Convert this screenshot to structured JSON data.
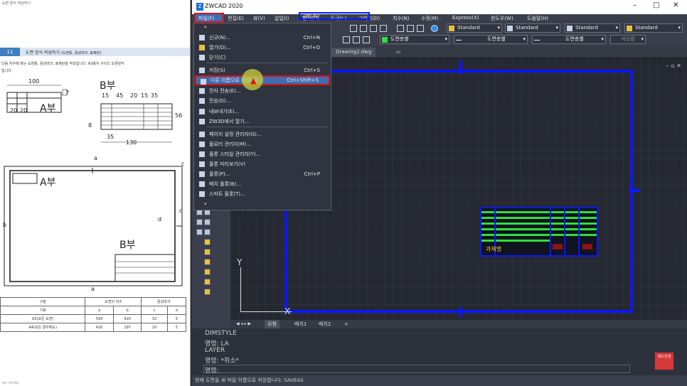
{
  "doc": {
    "toptxt": "도면 양식 작성하기",
    "sec_num": "11",
    "sec_title": "도면 양식 작성하기",
    "sec_title_small": "(도면틀, 중심마크, 표제란)",
    "body_line1": "다음 치수에 맞는 도면틀, 중심마크, 표제란을 작성합니다. A3용지 사이즈 도면양식",
    "body_line2": "입니다.",
    "label_A": "A부",
    "label_B": "B부",
    "dims": [
      "100",
      "15",
      "45",
      "20",
      "15",
      "35",
      "56",
      "35",
      "130",
      "20",
      "20",
      "7",
      "8",
      "a",
      "a",
      "b",
      "c",
      "d",
      "c"
    ],
    "table_headers": [
      "구분",
      "도면의 치수",
      "",
      "중심마크"
    ],
    "table_sub": [
      "기호",
      "a",
      "b",
      "c",
      "d"
    ],
    "table_row1": [
      "A3(모든 도면)",
      "594",
      "420",
      "10",
      "5"
    ],
    "table_row2": [
      "A4(모든 경우에도)",
      "420",
      "297",
      "10",
      "5"
    ],
    "footer": "캐드 아카데미"
  },
  "app": {
    "title": "ZWCAD 2020",
    "menus": [
      "파일(F)",
      "편집(E)",
      "뷰(V)",
      "삽입(I)",
      "형식(O)",
      "도구(L)",
      "그리기(D)",
      "치수(N)",
      "수정(M)",
      "Express(X)",
      "윈도우(W)",
      "도움말(H)"
    ],
    "style_dropdowns": [
      "Standard",
      "Standard",
      "Standard",
      "Standard"
    ],
    "layer_dropdown": "도면층별",
    "linetype_dropdown": "도면층별",
    "lineweight_dropdown": "도면층별",
    "color_dropdown": "색상별",
    "drawing_tab": "Drawing2.dwg",
    "drawing_label": "ZWCAD",
    "title_block_label": "과제명",
    "axis_x": "X",
    "axis_y": "Y",
    "layout_tabs": [
      "모형",
      "배치1",
      "배치2",
      "+"
    ],
    "cmd_lines": [
      "DIMSTYLE",
      "명령: LA",
      "LAYER",
      "명령: *취소*"
    ],
    "cmd_prompt": "명령:",
    "kr_badge": "캐드선생",
    "status": "현재 도면을 새 파일 이름으로 저장합니다:  SAVEAS"
  },
  "file_menu": {
    "items": [
      {
        "label": "신규(N)...",
        "shortcut": "Ctrl+N",
        "icon": "new-file-icon"
      },
      {
        "label": "열기(O)...",
        "shortcut": "Ctrl+O",
        "icon": "open-folder-icon"
      },
      {
        "label": "닫기(C)",
        "shortcut": "",
        "icon": "close-file-icon"
      },
      {
        "label": "저장(S)",
        "shortcut": "Ctrl+S",
        "icon": "save-icon"
      },
      {
        "label": "다른 이름으로 저장(A)...",
        "shortcut": "Ctrl+Shift+S",
        "icon": "save-as-icon"
      },
      {
        "label": "전자 전송(E)...",
        "shortcut": "",
        "icon": "etransmit-icon"
      },
      {
        "label": "전송(D)...",
        "shortcut": "",
        "icon": "send-icon"
      },
      {
        "label": "내보내기(E)...",
        "shortcut": "",
        "icon": "export-icon"
      },
      {
        "label": "ZW3D에서 열기...",
        "shortcut": "",
        "icon": "zw3d-icon"
      },
      {
        "label": "페이지 설정 관리자(G)...",
        "shortcut": "",
        "icon": "page-setup-icon"
      },
      {
        "label": "플로터 관리자(M)...",
        "shortcut": "",
        "icon": "plotter-icon"
      },
      {
        "label": "플롯 스타일 관리자(Y)...",
        "shortcut": "",
        "icon": "plot-style-icon"
      },
      {
        "label": "플롯 미리보기(V)",
        "shortcut": "",
        "icon": "plot-preview-icon"
      },
      {
        "label": "플롯(P)...",
        "shortcut": "Ctrl+P",
        "icon": "plot-icon"
      },
      {
        "label": "배치 플롯(B)...",
        "shortcut": "",
        "icon": "batch-plot-icon"
      },
      {
        "label": "스마트 플롯(T)...",
        "shortcut": "",
        "icon": "smart-plot-icon"
      }
    ]
  },
  "colors": {
    "accent": "#3f6db3",
    "highlight_border": "#e01010",
    "frame_blue": "#0a18ff",
    "title_green": "#2fe03a"
  }
}
